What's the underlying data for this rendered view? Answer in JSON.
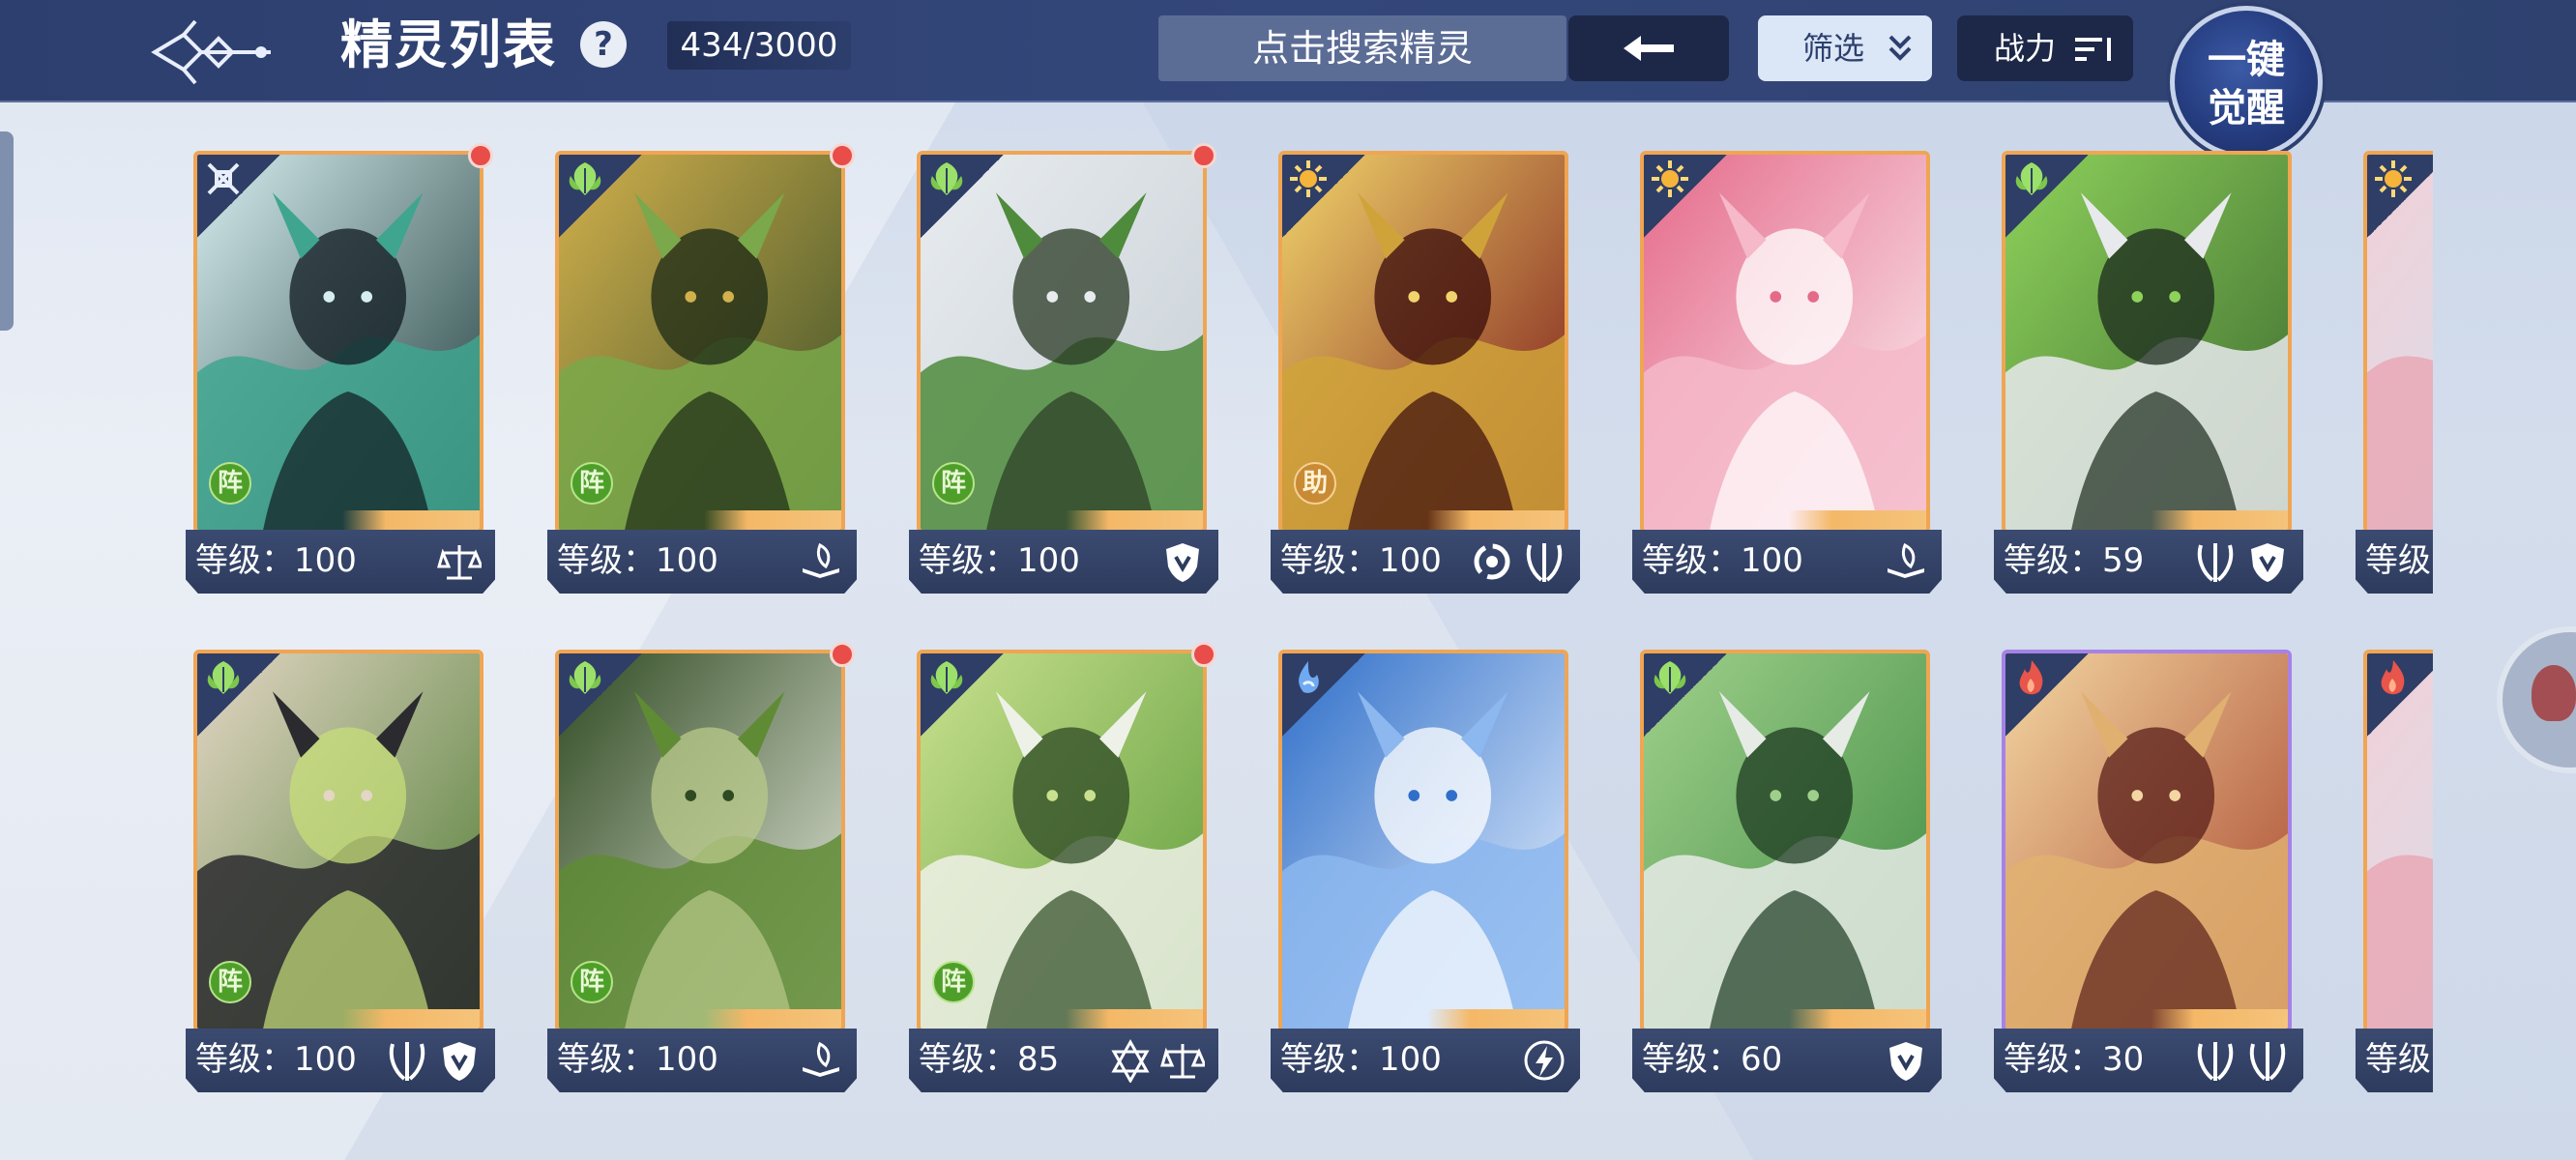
{
  "header": {
    "title": "精灵列表",
    "help": "?",
    "count": "434/3000",
    "search_placeholder": "点击搜索精灵",
    "filter_label": "筛选",
    "power_label": "战力",
    "awaken_line1": "一键",
    "awaken_line2": "觉醒"
  },
  "colors": {
    "header_bg": "#2d3f6e",
    "card_border": "#f0a552",
    "card_border_purple": "#a782e6",
    "red_dot": "#e84d49",
    "formation_badge": "#4e9f2a"
  },
  "cards": [
    {
      "level": "等级：100",
      "element": "mech-icon",
      "badge": "阵",
      "notify": true,
      "skills": [
        "balance-icon"
      ],
      "art": "dragon-sage"
    },
    {
      "level": "等级：100",
      "element": "leaf-icon",
      "badge": "阵",
      "notify": true,
      "skills": [
        "book-icon"
      ],
      "art": "green-dragon"
    },
    {
      "level": "等级：100",
      "element": "leaf-icon",
      "badge": "阵",
      "notify": true,
      "skills": [
        "shield-icon"
      ],
      "art": "silver-hair"
    },
    {
      "level": "等级：100",
      "element": "sun-icon",
      "badge": "助",
      "notify": false,
      "skills": [
        "vortex-icon",
        "claw-icon"
      ],
      "art": "red-warrior"
    },
    {
      "level": "等级：100",
      "element": "sun-icon",
      "badge": "",
      "notify": false,
      "skills": [
        "book-icon"
      ],
      "art": "white-fox"
    },
    {
      "level": "等级：59",
      "element": "leaf-icon",
      "badge": "",
      "notify": false,
      "skills": [
        "claw-icon",
        "shield-icon"
      ],
      "art": "green-knight"
    },
    {
      "level": "等级",
      "element": "sun-icon",
      "badge": "",
      "notify": false,
      "skills": [],
      "art": "partial",
      "partial": true
    },
    {
      "level": "等级：100",
      "element": "leaf-icon",
      "badge": "阵",
      "notify": false,
      "skills": [
        "claw-icon",
        "shield-icon"
      ],
      "art": "green-elf"
    },
    {
      "level": "等级：100",
      "element": "leaf-icon",
      "badge": "阵",
      "notify": true,
      "skills": [
        "book-icon"
      ],
      "art": "stag"
    },
    {
      "level": "等级：85",
      "element": "leaf-icon",
      "badge": "阵",
      "notify": true,
      "skills": [
        "hexagram-icon",
        "balance-icon"
      ],
      "art": "green-sage"
    },
    {
      "level": "等级：100",
      "element": "water-icon",
      "badge": "",
      "notify": false,
      "skills": [
        "lightning-icon"
      ],
      "art": "blue-fox"
    },
    {
      "level": "等级：60",
      "element": "leaf-icon",
      "badge": "",
      "notify": false,
      "skills": [
        "shield-icon"
      ],
      "art": "jade-dragon"
    },
    {
      "level": "等级：30",
      "element": "fire-icon",
      "badge": "",
      "notify": false,
      "skills": [
        "claw-icon",
        "claw-icon"
      ],
      "art": "fire-monk",
      "purple": true
    },
    {
      "level": "等级",
      "element": "fire-icon",
      "badge": "",
      "notify": false,
      "skills": [],
      "art": "partial",
      "partial": true
    }
  ]
}
